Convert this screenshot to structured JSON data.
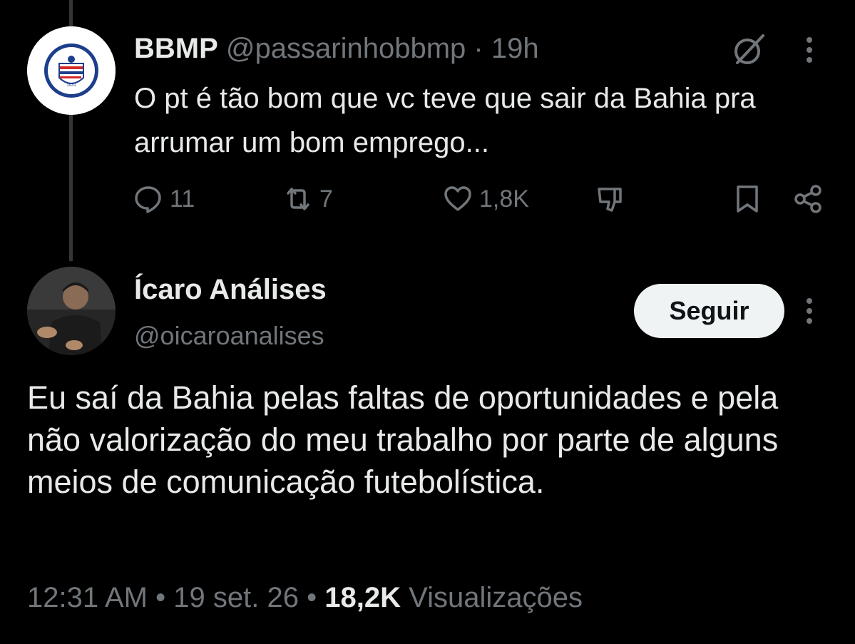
{
  "reply": {
    "display_name": "BBMP",
    "handle": "@passarinhobbmp",
    "separator": "·",
    "time": "19h",
    "text": "O pt é tão bom que vc teve que sair da Bahia pra arrumar um bom emprego...",
    "avatar_icon": "esporte-clube-bahia-crest",
    "avatar_text": "ESPORTE CLUBE BAHIA",
    "avatar_year": "1931",
    "actions": {
      "replies": "11",
      "reposts": "7",
      "likes": "1,8K"
    }
  },
  "tweet": {
    "display_name": "Ícaro Análises",
    "handle": "@oicaroanalises",
    "follow_label": "Seguir",
    "text": "Eu saí da Bahia pelas faltas de oportunidades e pela não valorização do meu trabalho por parte de alguns meios de comunicação futebolística.",
    "time": "12:31 AM",
    "dot": "•",
    "date": "19 set. 26",
    "views_count": "18,2K",
    "views_label": "Visualizações"
  },
  "colors": {
    "background": "#000000",
    "text": "#e7e9ea",
    "muted": "#71767b",
    "thread_line": "#333639",
    "follow_bg": "#eff3f4",
    "bahia_blue": "#1d3e8c",
    "bahia_red": "#d42a2a"
  }
}
